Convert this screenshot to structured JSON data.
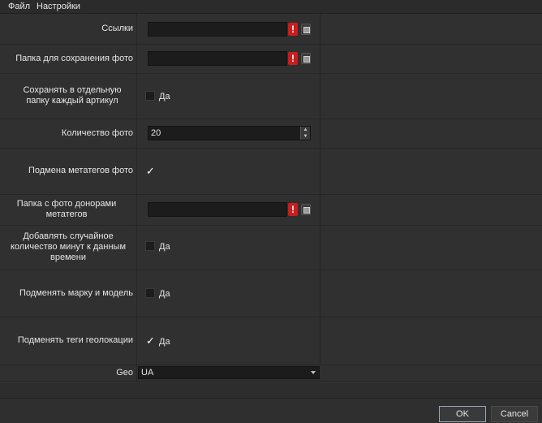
{
  "menu": {
    "file": "Файл",
    "settings": "Настройки"
  },
  "fields": {
    "links_label": "Ссылки",
    "save_folder_label": "Папка для сохранения фото",
    "separate_folder_label": "Сохранять в отдельную папку каждый артикул",
    "separate_folder_value": "Да",
    "photo_count_label": "Количество фото",
    "photo_count_value": "20",
    "replace_meta_label": "Подмена метатегов фото",
    "donor_folder_label": "Папка с фото донорами метатегов",
    "add_random_minutes_label": "Добавлять случайное количество минут к данным времени",
    "add_random_minutes_value": "Да",
    "replace_brand_label": "Подменять марку и модель",
    "replace_brand_value": "Да",
    "replace_geo_label": "Подменять теги геолокации",
    "replace_geo_value": "Да",
    "geo_label": "Geo",
    "geo_value": "UA"
  },
  "states": {
    "separate_folder_checked": false,
    "replace_meta_checked": true,
    "add_random_minutes_checked": false,
    "replace_brand_checked": false,
    "replace_geo_checked": true
  },
  "warning_icon": "!",
  "buttons": {
    "ok": "OK",
    "cancel": "Cancel"
  }
}
